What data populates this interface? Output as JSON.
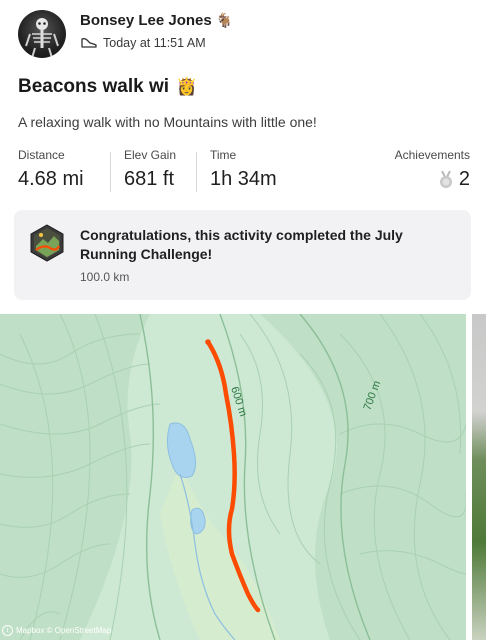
{
  "athlete": {
    "name": "Bonsey Lee Jones",
    "name_emoji": "🐐",
    "timestamp": "Today at 11:51 AM",
    "activity_type_icon": "hiking-shoe-icon"
  },
  "activity": {
    "title": "Beacons walk wi",
    "title_emoji": "👸",
    "description": "A relaxing walk with no Mountains with little one!"
  },
  "stats": [
    {
      "label": "Distance",
      "value": "4.68 mi"
    },
    {
      "label": "Elev Gain",
      "value": "681 ft"
    },
    {
      "label": "Time",
      "value": "1h 34m"
    }
  ],
  "achievements": {
    "label": "Achievements",
    "value": "2",
    "icon": "medal-icon"
  },
  "challenge": {
    "title": "Congratulations, this activity completed the July Running Challenge!",
    "subtitle": "100.0 km",
    "icon": "challenge-badge-icon"
  },
  "map": {
    "contour_labels": [
      "600 m",
      "700 m"
    ],
    "attribution": "Mapbox © OpenStreetMap",
    "route_color": "#fc4c02",
    "water_color": "#a8d4f0"
  }
}
